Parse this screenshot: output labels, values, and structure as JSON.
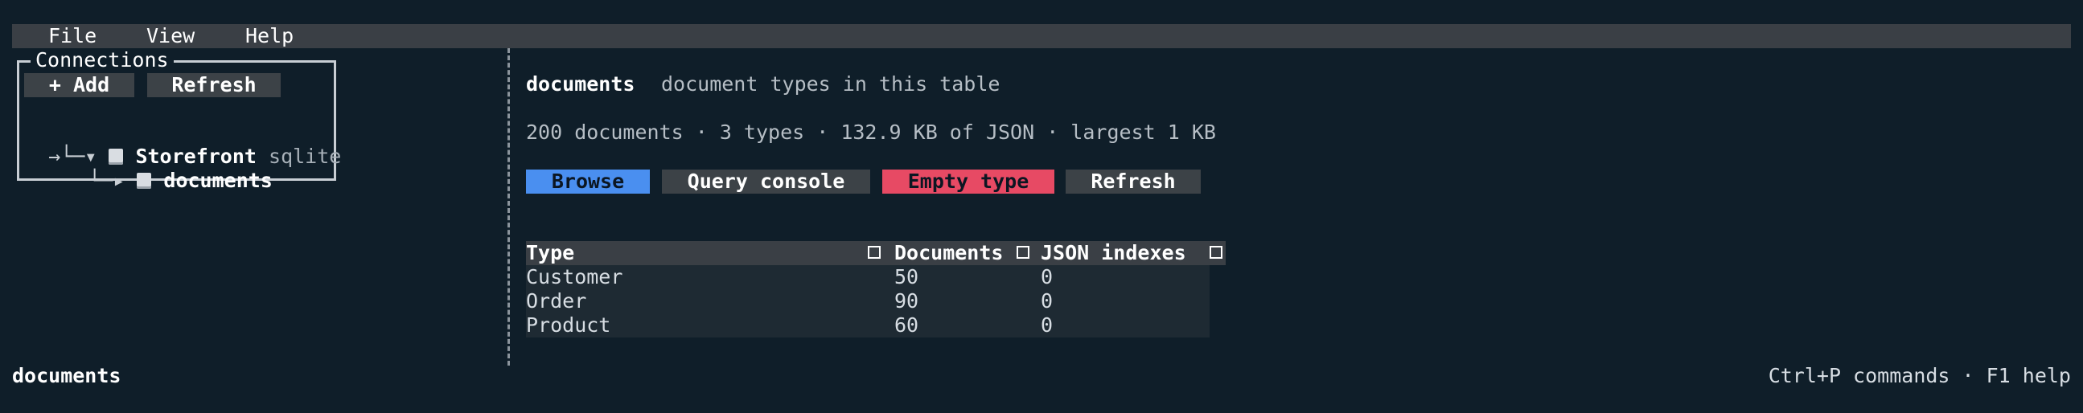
{
  "menu": {
    "items": [
      "File",
      "View",
      "Help"
    ]
  },
  "connections": {
    "title": "Connections",
    "add_label": "+ Add",
    "refresh_label": "Refresh",
    "tree": {
      "root_prefix": "→└─▾ ",
      "root_name": "Storefront",
      "root_type": "sqlite",
      "child_prefix": "└─▸ ",
      "child_name": "documents"
    }
  },
  "main": {
    "title": "documents",
    "subtitle": "document types in this table",
    "stats": "200 documents · 3 types · 132.9 KB of JSON · largest 1 KB",
    "buttons": {
      "browse": "Browse",
      "query_console": "Query console",
      "empty_type": "Empty type",
      "refresh": "Refresh"
    },
    "table": {
      "headers": [
        "Type",
        "Documents",
        "JSON indexes"
      ],
      "rows": [
        [
          "Customer",
          "50",
          "0"
        ],
        [
          "Order",
          "90",
          "0"
        ],
        [
          "Product",
          "60",
          "0"
        ]
      ]
    }
  },
  "footer": {
    "left": "documents",
    "right": "Ctrl+P commands · F1 help"
  },
  "colors": {
    "background": "#0f1e29",
    "accent_blue": "#4a8ff0",
    "accent_red": "#e74a64",
    "bar_gray": "#3a3f45"
  },
  "icons": {
    "database": "database-icon",
    "table": "table-icon",
    "column_marker": "square-icon"
  }
}
